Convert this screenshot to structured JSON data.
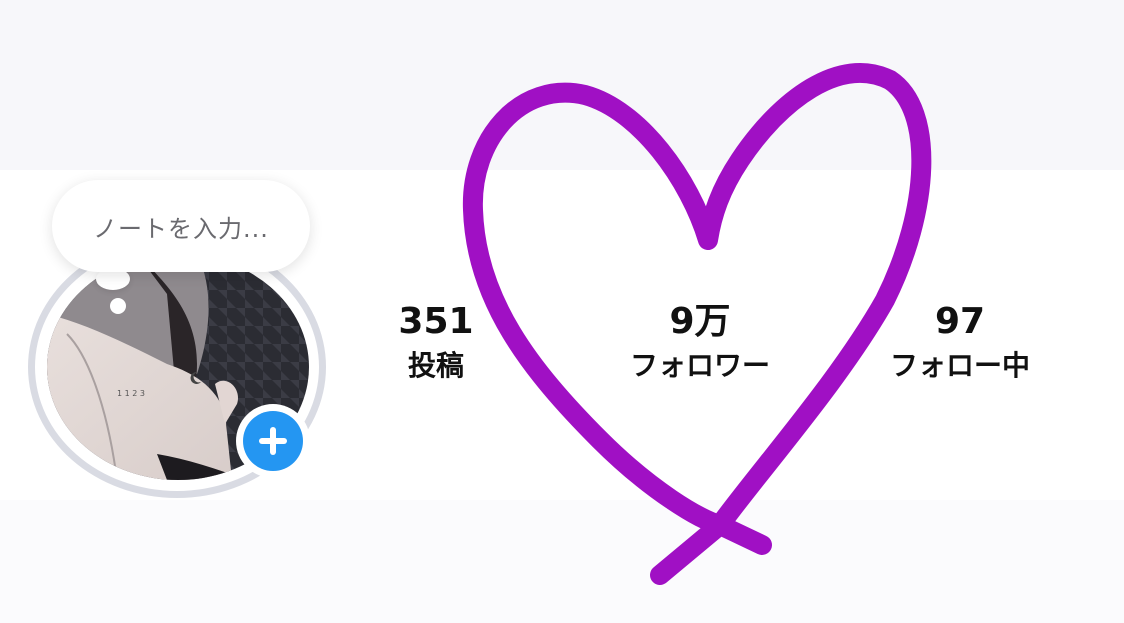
{
  "note": {
    "placeholder": "ノートを入力..."
  },
  "stats": {
    "posts": {
      "value": "351",
      "label": "投稿"
    },
    "followers": {
      "value": "9万",
      "label": "フォロワー"
    },
    "following": {
      "value": "97",
      "label": "フォロー中"
    }
  },
  "colors": {
    "heart": "#a010c4",
    "plus_button": "#2496f2",
    "avatar_ring": "#d9dbe3"
  },
  "icons": {
    "add_story": "plus-icon",
    "heart_doodle": "heart-icon"
  }
}
